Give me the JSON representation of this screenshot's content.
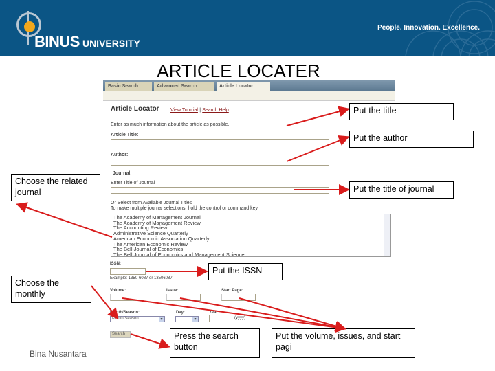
{
  "header": {
    "logo": "BINUS UNIVERSITY",
    "logo_main": "BINUS",
    "logo_sub": "UNIVERSITY",
    "tagline": "People. Innovation. Excellence.",
    "color": "#0b5585"
  },
  "slide_title": "ARTICLE LOCATER",
  "screenshot": {
    "tabs": [
      {
        "label": "Basic Search"
      },
      {
        "label": "Advanced Search"
      },
      {
        "label": "Article Locator",
        "active": true
      }
    ],
    "heading": "Article Locator",
    "view_tutorial": "View Tutorial",
    "separator": "|",
    "search_help": "Search Help",
    "intro": "Enter as much information about the article as possible.",
    "article_title_label": "Article Title:",
    "author_label": "Author:",
    "journal_label": "Journal:",
    "journal_title_label": "Enter Title of Journal",
    "or_select": "Or Select from Available Journal Titles",
    "multi_hint": "To make multiple journal selections, hold the control or command key.",
    "journals": [
      "The Academy of Management Journal",
      "The Academy of Management Review",
      "The Accounting Review",
      "Administrative Science Quarterly",
      "American Economic Association Quarterly",
      "The American Economic Review",
      "The Bell Journal of Economics",
      "The Bell Journal of Economics and Management Science"
    ],
    "issn_label": "ISSN:",
    "issn_example": "Example: 1350-6087 or 13506087",
    "volume_label": "Volume:",
    "issue_label": "Issue:",
    "start_page_label": "Start Page:",
    "month_label": "Month/Season:",
    "month_value": "Month/Season",
    "day_label": "Day:",
    "year_label": "Year:",
    "year_hint": "(yyyy)",
    "search_button": "Search"
  },
  "callouts": {
    "title": "Put the title",
    "author": "Put the author",
    "journal_title": "Put the title of journal",
    "related_journal": "Choose the related journal",
    "monthly": "Choose the monthly",
    "issn": "Put the ISSN",
    "search": "Press the search button",
    "volume": "Put the volume, issues, and start pagi"
  },
  "arrow_color": "#d91c1c",
  "footer": "Bina Nusantara"
}
